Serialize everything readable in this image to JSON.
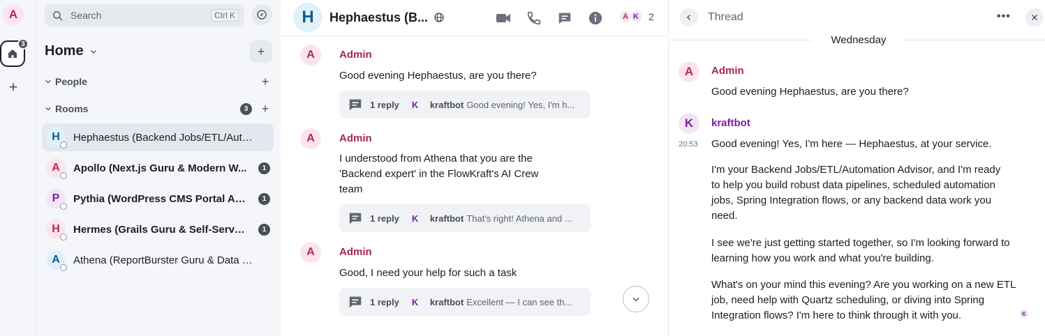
{
  "user_avatar": "A",
  "spacebar": {
    "home_badge": "3"
  },
  "search": {
    "placeholder": "Search",
    "shortcut": "Ctrl K"
  },
  "home": {
    "title": "Home"
  },
  "sections": {
    "people": "People",
    "rooms": "Rooms",
    "rooms_badge": "3"
  },
  "rooms": [
    {
      "initial": "H",
      "name": "Hephaestus (Backend Jobs/ETL/Auto...",
      "badge": "",
      "bold": false,
      "selected": true,
      "bg": "#e0f1fa",
      "fg": "#0b5f8a"
    },
    {
      "initial": "A",
      "name": "Apollo (Next.js Guru & Modern W...",
      "badge": "1",
      "bold": true,
      "selected": false,
      "bg": "#fce4ec",
      "fg": "#b0285f"
    },
    {
      "initial": "P",
      "name": "Pythia (WordPress CMS Portal Ad...",
      "badge": "1",
      "bold": true,
      "selected": false,
      "bg": "#f3e5f5",
      "fg": "#7b1fa2"
    },
    {
      "initial": "H",
      "name": "Hermes (Grails Guru & Self-Servic...",
      "badge": "1",
      "bold": true,
      "selected": false,
      "bg": "#fce4ec",
      "fg": "#b0285f"
    },
    {
      "initial": "A",
      "name": "Athena (ReportBurster Guru & Data M...",
      "badge": "",
      "bold": false,
      "selected": false,
      "bg": "#e0f1fa",
      "fg": "#0b5f8a"
    }
  ],
  "room_header": {
    "initial": "H",
    "title": "Hephaestus (B...",
    "facepile": [
      "A",
      "K"
    ],
    "member_count": "2"
  },
  "timeline": {
    "messages": [
      {
        "initial": "A",
        "sender": "Admin",
        "lines": [
          "Good evening Hephaestus, are you there?"
        ],
        "thread": {
          "replies": "1 reply",
          "initial": "K",
          "name": "kraftbot",
          "preview": "Good evening! Yes, I'm h..."
        }
      },
      {
        "initial": "A",
        "sender": "Admin",
        "lines": [
          "I understood from Athena that you are the",
          "'Backend expert' in the FlowKraft's AI Crew",
          "team"
        ],
        "thread": {
          "replies": "1 reply",
          "initial": "K",
          "name": "kraftbot",
          "preview": "That's right! Athena and ..."
        }
      },
      {
        "initial": "A",
        "sender": "Admin",
        "lines": [
          "Good, I need your help for such a task"
        ],
        "thread": {
          "replies": "1 reply",
          "initial": "K",
          "name": "kraftbot",
          "preview": "Excellent — I can see th..."
        }
      }
    ]
  },
  "thread": {
    "title": "Thread",
    "more": "•••",
    "date": "Wednesday",
    "root": {
      "initial": "A",
      "sender": "Admin",
      "text": "Good evening Hephaestus, are you there?"
    },
    "reply": {
      "initial": "K",
      "sender": "kraftbot",
      "time": "20:53",
      "paragraphs": [
        "Good evening! Yes, I'm here — Hephaestus, at your service.",
        "I'm your Backend Jobs/ETL/Automation Advisor, and I'm ready to help you build robust data pipelines, scheduled automation jobs, Spring Integration flows, or any backend data work you need.",
        "I see we're just getting started together, so I'm looking forward to learning how you work and what you're building.",
        "What's on your mind this evening? Are you working on a new ETL job, need help with Quartz scheduling, or diving into Spring Integration flows? I'm here to think through it with you."
      ],
      "read_receipt": "K"
    }
  },
  "colors": {
    "admin": "#a8245b",
    "kraftbot": "#7b1fa2",
    "accent": "#0b5f8a"
  }
}
